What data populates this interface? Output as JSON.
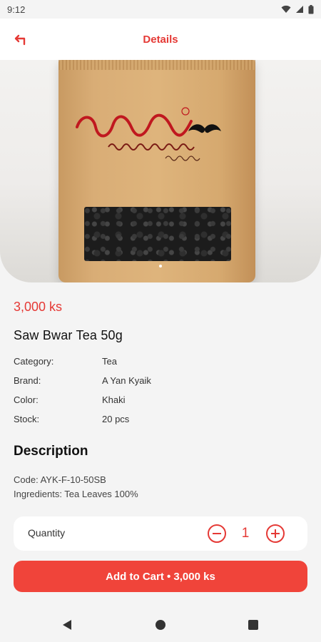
{
  "status_bar": {
    "time": "9:12",
    "icons": [
      "wifi-icon",
      "signal-icon",
      "battery-icon"
    ]
  },
  "app_bar": {
    "title": "Details",
    "back_icon": "back-arrow-icon"
  },
  "product": {
    "price": "3,000 ks",
    "name": "Saw Bwar Tea 50g",
    "attributes": [
      {
        "label": "Category:",
        "value": "Tea"
      },
      {
        "label": "Brand:",
        "value": "A Yan Kyaik"
      },
      {
        "label": "Color:",
        "value": "Khaki"
      },
      {
        "label": "Stock:",
        "value": "20 pcs"
      }
    ]
  },
  "description": {
    "title": "Description",
    "lines": [
      "Code: AYK-F-10-50SB",
      "Ingredients: Tea Leaves 100%"
    ]
  },
  "quantity": {
    "label": "Quantity",
    "value": "1"
  },
  "cart_button": {
    "label": "Add to Cart • 3,000 ks"
  },
  "colors": {
    "accent": "#e53935",
    "button": "#f0443a",
    "background": "#f4f4f4"
  }
}
